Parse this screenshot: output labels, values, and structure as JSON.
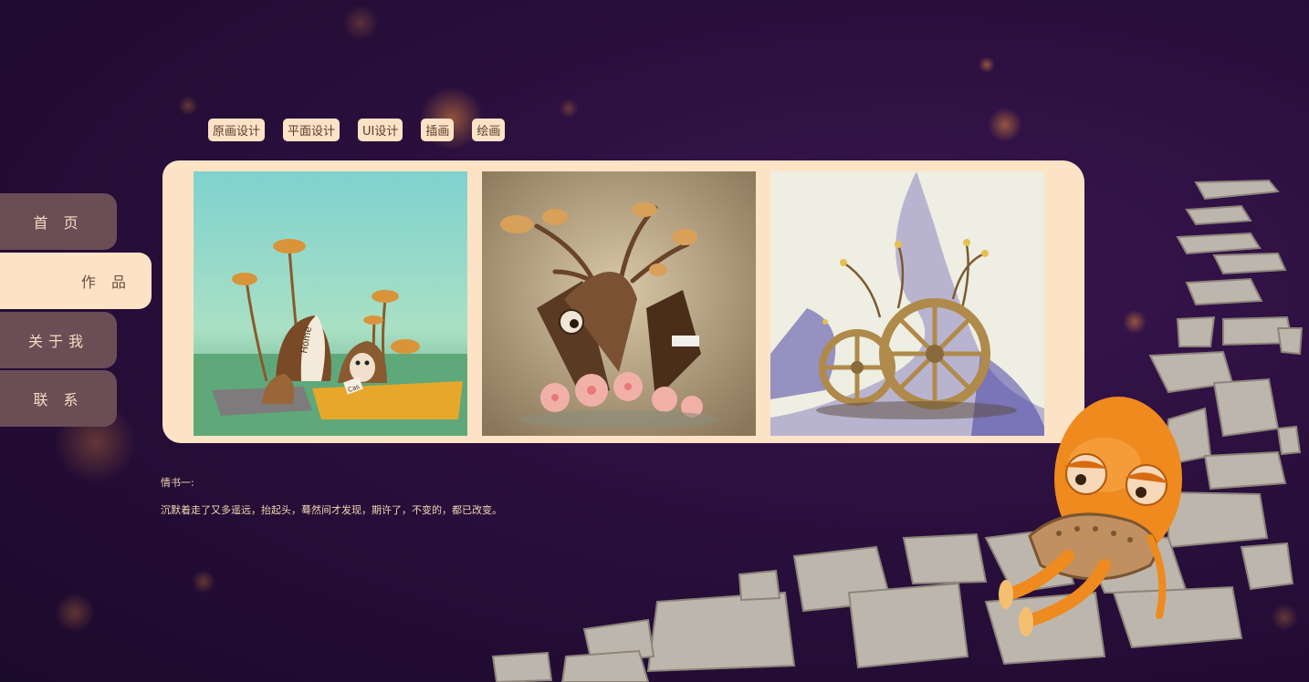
{
  "nav": {
    "items": [
      {
        "label": "首 页"
      },
      {
        "label": "作 品"
      },
      {
        "label": "关于我"
      },
      {
        "label": "联 系"
      }
    ],
    "active_index": 1
  },
  "tabs": [
    {
      "label": "原画设计"
    },
    {
      "label": "平面设计"
    },
    {
      "label": "UI设计"
    },
    {
      "label": "插画"
    },
    {
      "label": "绘画"
    }
  ],
  "gallery": {
    "items": [
      {
        "name": "mushroom-home-illustration",
        "sign_top": "Home",
        "sign_bottom": "Cas"
      },
      {
        "name": "letter-v-creature-illustration"
      },
      {
        "name": "wooden-wheels-illustration"
      }
    ]
  },
  "quote": {
    "title": "情书一:",
    "body": "沉默着走了又多遥远，抬起头，蓦然间才发现，期许了，不变的，都已改变。"
  },
  "colors": {
    "background": "#2a0f3d",
    "panel": "#fde3c6",
    "nav_inactive": "#6b4d55",
    "text_light": "#f2d8b0"
  }
}
